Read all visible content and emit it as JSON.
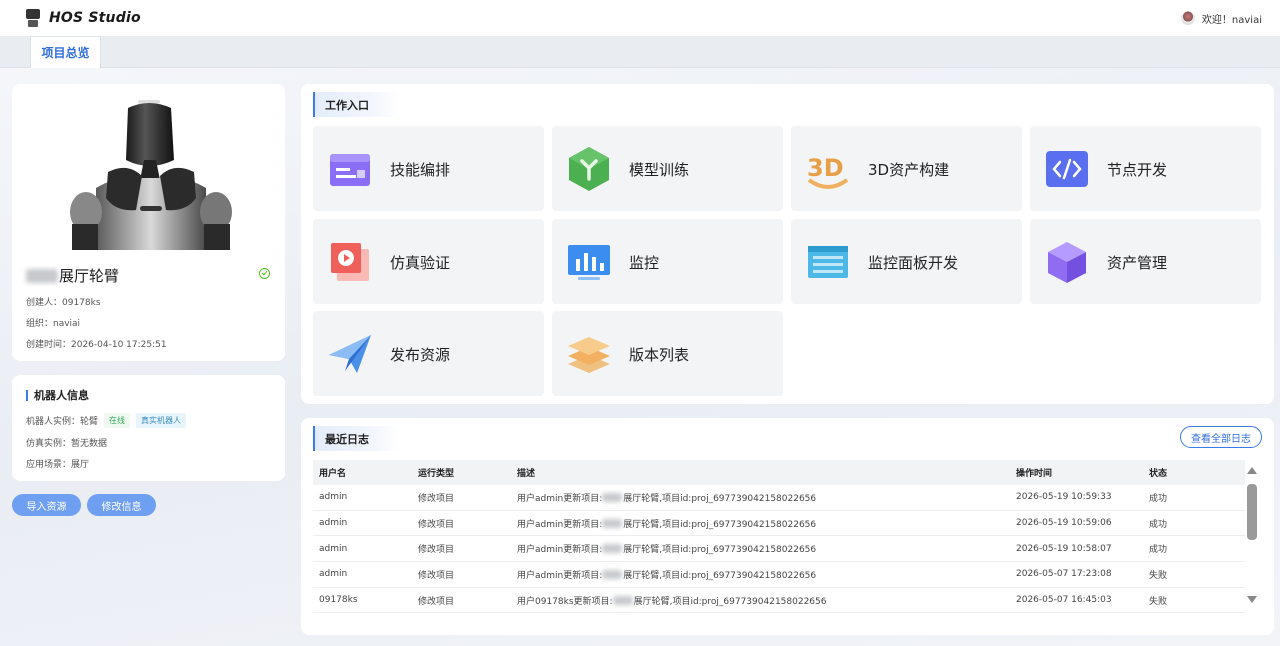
{
  "app": {
    "title": "HOS Studio"
  },
  "user": {
    "greeting": "欢迎！naviai"
  },
  "tabs": [
    {
      "label": "项目总览"
    }
  ],
  "project": {
    "name_suffix": "展厅轮臂",
    "robot_brand": "NAVIAI",
    "creator": "创建人：09178ks",
    "org": "组织：naviai",
    "created_time": "创建时间：2026-04-10 17:25:51"
  },
  "robot_info": {
    "title": "机器人信息",
    "instance_label": "机器人实例：轮臂",
    "status_badge": "在线",
    "type_badge": "真实机器人",
    "sim_instance": "仿真实例：暂无数据",
    "scene": "应用场景：展厅"
  },
  "buttons": {
    "import": "导入资源",
    "edit": "修改信息",
    "view_all_logs": "查看全部日志"
  },
  "work_entry": {
    "title": "工作入口",
    "tiles": [
      {
        "label": "技能编排",
        "icon": "skill-orchestration-icon"
      },
      {
        "label": "模型训练",
        "icon": "model-training-icon"
      },
      {
        "label": "3D资产构建",
        "icon": "3d-asset-icon"
      },
      {
        "label": "节点开发",
        "icon": "code-icon"
      },
      {
        "label": "仿真验证",
        "icon": "simulation-play-icon"
      },
      {
        "label": "监控",
        "icon": "monitor-chart-icon"
      },
      {
        "label": "监控面板开发",
        "icon": "dashboard-icon"
      },
      {
        "label": "资产管理",
        "icon": "cube-icon"
      },
      {
        "label": "发布资源",
        "icon": "paper-plane-icon"
      },
      {
        "label": "版本列表",
        "icon": "layers-icon"
      }
    ]
  },
  "logs": {
    "title": "最近日志",
    "headers": [
      "用户名",
      "运行类型",
      "描述",
      "操作时间",
      "状态"
    ],
    "rows": [
      {
        "user": "admin",
        "type": "修改项目",
        "desc_prefix": "用户admin更新项目:",
        "desc_suffix": "展厅轮臂,项目id:proj_697739042158022656",
        "time": "2026-05-19 10:59:33",
        "status": "成功"
      },
      {
        "user": "admin",
        "type": "修改项目",
        "desc_prefix": "用户admin更新项目:",
        "desc_suffix": "展厅轮臂,项目id:proj_697739042158022656",
        "time": "2026-05-19 10:59:06",
        "status": "成功"
      },
      {
        "user": "admin",
        "type": "修改项目",
        "desc_prefix": "用户admin更新项目:",
        "desc_suffix": "展厅轮臂,项目id:proj_697739042158022656",
        "time": "2026-05-19 10:58:07",
        "status": "成功"
      },
      {
        "user": "admin",
        "type": "修改项目",
        "desc_prefix": "用户admin更新项目:",
        "desc_suffix": "展厅轮臂,项目id:proj_697739042158022656",
        "time": "2026-05-07 17:23:08",
        "status": "失败"
      },
      {
        "user": "09178ks",
        "type": "修改项目",
        "desc_prefix": "用户09178ks更新项目:",
        "desc_suffix": "展厅轮臂,项目id:proj_697739042158022656",
        "time": "2026-05-07 16:45:03",
        "status": "失败"
      }
    ]
  },
  "colors": {
    "accent": "#2f6ee0",
    "success": "#52c41a",
    "button": "#6f9ff0"
  }
}
